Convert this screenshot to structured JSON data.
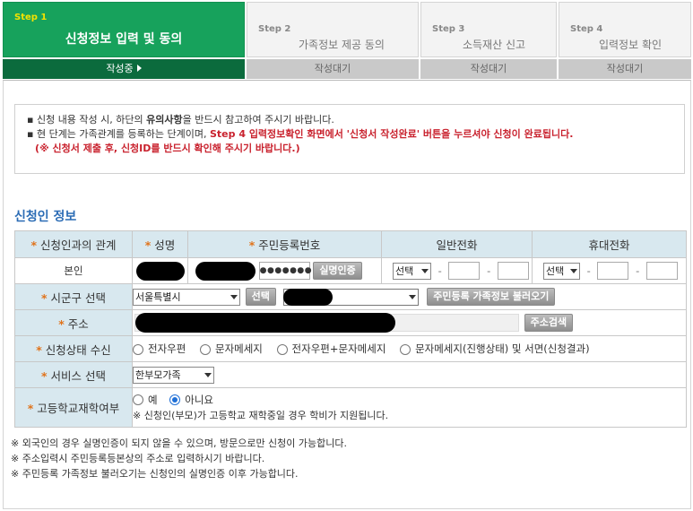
{
  "steps": [
    {
      "num": "Step 1",
      "title": "신청정보 입력 및 동의",
      "status": "작성중"
    },
    {
      "num": "Step 2",
      "title": "가족정보 제공 동의",
      "status": "작성대기"
    },
    {
      "num": "Step 3",
      "title": "소득재산 신고",
      "status": "작성대기"
    },
    {
      "num": "Step 4",
      "title": "입력정보 확인",
      "status": "작성대기"
    }
  ],
  "notice": {
    "line1_a": "신청 내용 작성 시, 하단의 ",
    "line1_b": "유의사항",
    "line1_c": "을 반드시 참고하여 주시기 바랍니다.",
    "line2_a": "현 단계는 가족관계를 등록하는 단계이며, ",
    "line2_b": "Step 4 입력정보확인 화면에서 '신청서 작성완료' 버튼을 누르셔야 신청이 완료됩니다.",
    "line3": "(※ 신청서 제출 후, 신청ID를 반드시 확인해 주시기 바랍니다.)"
  },
  "section_title": "신청인 정보",
  "table": {
    "headers": [
      "신청인과의 관계",
      "성명",
      "주민등록번호",
      "일반전화",
      "휴대전화"
    ],
    "relation_value": "본인",
    "rrn_masked": "●●●●●●●",
    "verify_button": "실명인증",
    "phone_select": "선택",
    "mobile_select": "선택",
    "dash": "-",
    "region_label": "시군구 선택",
    "city_select": "서울특별시",
    "select_button": "선택",
    "load_family_button": "주민등록 가족정보 불러오기",
    "address_label": "주소",
    "address_search_button": "주소검색",
    "status_label": "신청상태 수신",
    "status_options": [
      "전자우편",
      "문자메세지",
      "전자우편+문자메세지",
      "문자메세지(진행상태) 및 서면(신청결과)"
    ],
    "service_label": "서비스 선택",
    "service_select": "한부모가족",
    "school_label": "고등학교재학여부",
    "school_yes": "예",
    "school_no": "아니요",
    "school_note": "※ 신청인(부모)가 고등학교 재학중일 경우 학비가 지원됩니다."
  },
  "footnotes": [
    "※ 외국인의 경우 실명인증이 되지 않을 수 있으며, 방문으로만 신청이 가능합니다.",
    "※ 주소입력시 주민등록등본상의 주소로 입력하시기 바랍니다.",
    "※ 주민등록 가족정보 불러오기는 신청인의 실명인증 이후 가능합니다."
  ],
  "colors": {
    "active_green": "#17a25c",
    "active_dark": "#0b6b3d",
    "header_bg": "#d8e8ef",
    "title_blue": "#2b6cb5",
    "notice_red": "#c9222e"
  }
}
